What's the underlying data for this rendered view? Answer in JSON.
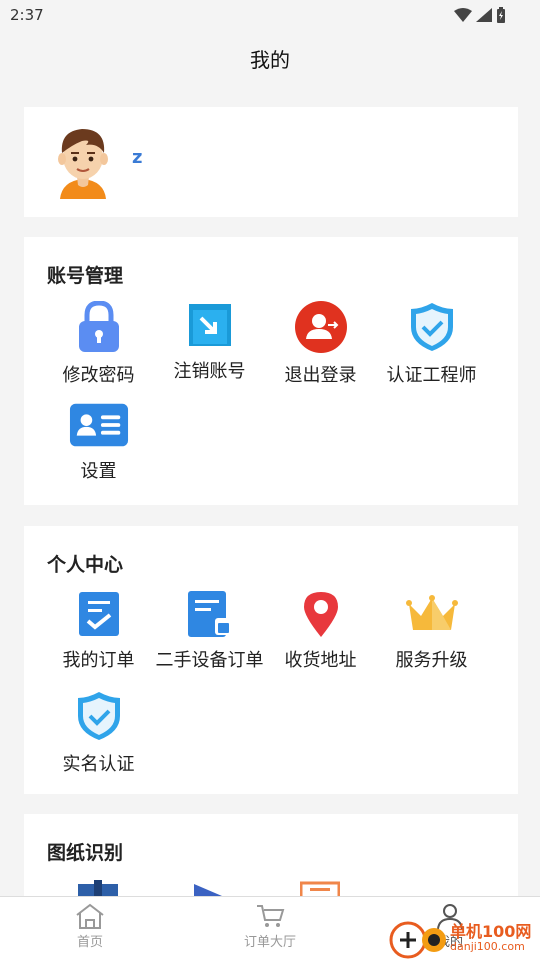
{
  "status_bar": {
    "time": "2:37"
  },
  "page_title": "我的",
  "profile": {
    "username": "z"
  },
  "account_section": {
    "title": "账号管理",
    "items": [
      {
        "label": "修改密码",
        "icon": "lock-icon"
      },
      {
        "label": "注销账号",
        "icon": "logout-box-icon"
      },
      {
        "label": "退出登录",
        "icon": "user-exit-icon"
      },
      {
        "label": "认证工程师",
        "icon": "shield-check-icon"
      },
      {
        "label": "设置",
        "icon": "id-card-icon"
      }
    ]
  },
  "personal_section": {
    "title": "个人中心",
    "items": [
      {
        "label": "我的订单",
        "icon": "order-icon"
      },
      {
        "label": "二手设备订单",
        "icon": "equipment-order-icon"
      },
      {
        "label": "收货地址",
        "icon": "location-pin-icon"
      },
      {
        "label": "服务升级",
        "icon": "crown-icon"
      },
      {
        "label": "实名认证",
        "icon": "shield-check-icon"
      }
    ]
  },
  "drawing_section": {
    "title": "图纸识别"
  },
  "tab_bar": {
    "tabs": [
      {
        "label": "首页",
        "icon": "home-icon"
      },
      {
        "label": "订单大厅",
        "icon": "cart-icon"
      },
      {
        "label": "我的",
        "icon": "user-icon"
      }
    ]
  },
  "watermark": {
    "text": "单机100网",
    "sub": "danji100.com"
  },
  "colors": {
    "accent": "#3a7bd5",
    "background": "#f4f4f4",
    "red": "#e0321f",
    "gold": "#f6b93b"
  }
}
